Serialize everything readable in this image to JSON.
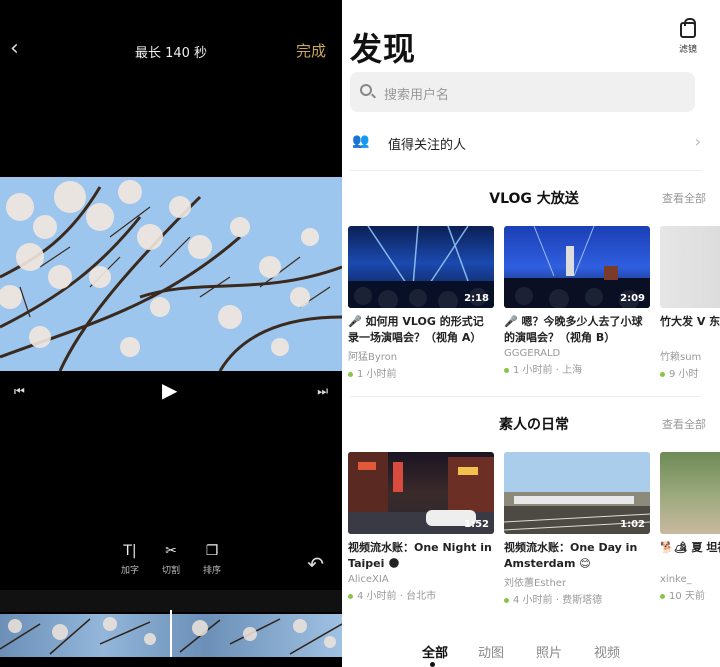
{
  "editor": {
    "title": "最长 140 秒",
    "done_label": "完成",
    "tools": [
      {
        "icon": "text-icon",
        "glyph": "T|",
        "label": "加字"
      },
      {
        "icon": "scissors-icon",
        "glyph": "✂",
        "label": "切割"
      },
      {
        "icon": "sort-icon",
        "glyph": "❐",
        "label": "排序"
      }
    ]
  },
  "discover": {
    "title": "发现",
    "filter_label": "滤镜",
    "search_placeholder": "搜索用户名",
    "follow_label": "值得关注的人",
    "sections": [
      {
        "title": "VLOG 大放送",
        "more": "查看全部",
        "cards": [
          {
            "title": "🎤 如何用 VLOG 的形式记录一场演唱会？（视角 A）",
            "author": "阿猛Byron",
            "meta": "1 小时前",
            "duration": "2:18"
          },
          {
            "title": "🎤 嗯？今晚多少人去了小球的演唱会？（视角 B）",
            "author": "GGGERALD",
            "meta": "1 小时前 · 上海",
            "duration": "2:09"
          },
          {
            "title": "竹大发 V 东京大学",
            "author": "竹赖sum",
            "meta": "9 小时",
            "duration": ""
          }
        ]
      },
      {
        "title": "素人の日常",
        "more": "查看全部",
        "cards": [
          {
            "title": "视频流水账：One Night in Taipei 🌑",
            "author": "AliceXIA",
            "meta": "4 小时前 · 台北市",
            "duration": "1:52"
          },
          {
            "title": "视频流水账：One Day in Amsterdam 😊",
            "author": "刘依蕙Esther",
            "meta": "4 小时前 · 费斯塔德",
            "duration": "1:02"
          },
          {
            "title": "🐕🏕 夏 坦福学姐",
            "author": "xinke_",
            "meta": "10 天前",
            "duration": ""
          }
        ]
      }
    ],
    "tabs": [
      "全部",
      "动图",
      "照片",
      "视频"
    ]
  }
}
